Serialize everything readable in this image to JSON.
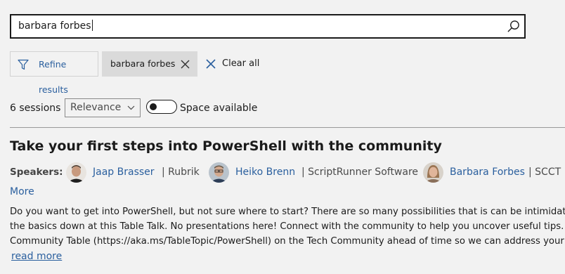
{
  "search": {
    "value": "barbara forbes"
  },
  "filters": {
    "refine_label": "Refine results",
    "active_chip": "barbara forbes",
    "clear_all_label": "Clear all"
  },
  "results": {
    "count_label": "6 sessions",
    "sort_selected": "Relevance",
    "space_available_label": "Space available",
    "space_available_on": false
  },
  "session": {
    "title": "Take your first steps into PowerShell with the community",
    "speakers_label": "Speakers:",
    "speakers": [
      {
        "name": "Jaap Brasser",
        "org": "| Rubrik"
      },
      {
        "name": "Heiko Brenn",
        "org": "| ScriptRunner Software"
      },
      {
        "name": "Barbara Forbes",
        "org": "| SCCT"
      }
    ],
    "more_label": "More",
    "description_lines": [
      "Do you want to get into PowerShell, but not sure where to start? There are so many possibilities that is can be intimidati",
      "the basics down at this Table Talk. No presentations here! Connect with the community to help you uncover useful tips. .",
      "Community Table (https://aka.ms/TableTopic/PowerShell) on the Tech Community ahead of time so we can address your"
    ],
    "read_more_label": "read more"
  },
  "colors": {
    "link": "#2a5f9e",
    "background": "#f2f2f2",
    "text": "#1b1b1b"
  }
}
